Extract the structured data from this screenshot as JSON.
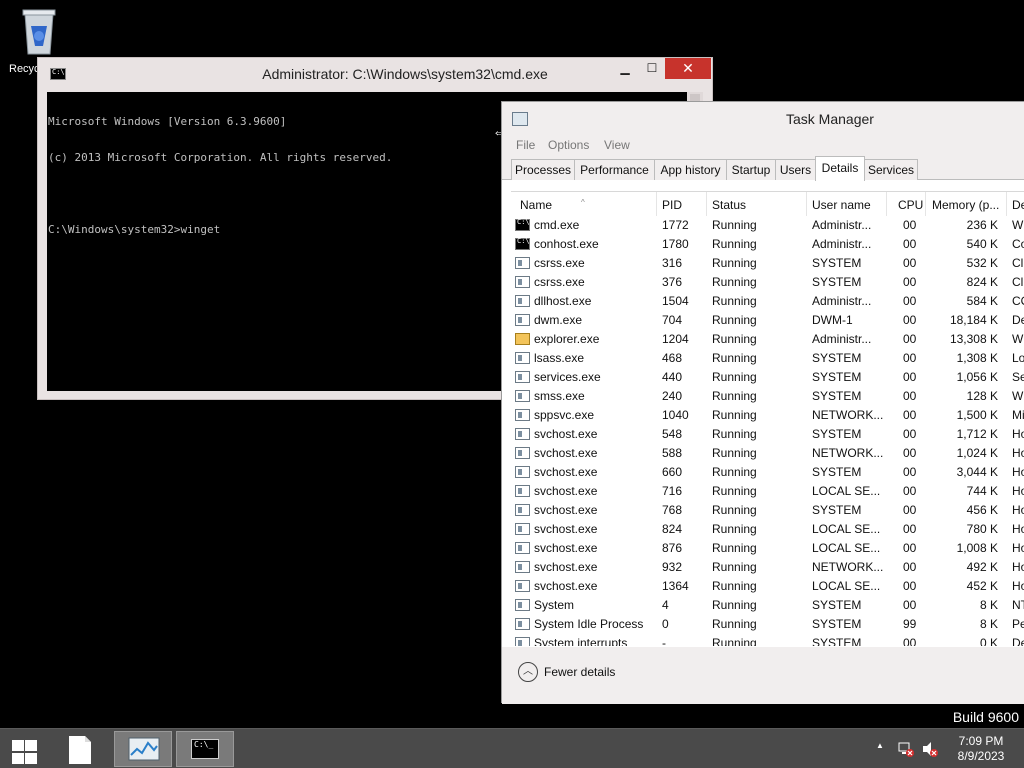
{
  "desktop": {
    "recycle_label": "Recyc",
    "build_label": "Build 9600"
  },
  "cmd": {
    "title": "Administrator: C:\\Windows\\system32\\cmd.exe",
    "minimize": "▁",
    "maximize": "☐",
    "close": "✕",
    "lines": [
      "Microsoft Windows [Version 6.3.9600]",
      "(c) 2013 Microsoft Corporation. All rights reserved.",
      "",
      "C:\\Windows\\system32>winget"
    ]
  },
  "taskmgr": {
    "title": "Task Manager",
    "menu": [
      "File",
      "Options",
      "View"
    ],
    "tabs": [
      "Processes",
      "Performance",
      "App history",
      "Startup",
      "Users",
      "Details",
      "Services"
    ],
    "active_tab": "Details",
    "columns": [
      "Name",
      "PID",
      "Status",
      "User name",
      "CPU",
      "Memory (p...",
      "De"
    ],
    "rows": [
      {
        "icon": "cmd",
        "name": "cmd.exe",
        "pid": "1772",
        "status": "Running",
        "user": "Administr...",
        "cpu": "00",
        "mem": "236 K",
        "desc": "Wi"
      },
      {
        "icon": "cmd",
        "name": "conhost.exe",
        "pid": "1780",
        "status": "Running",
        "user": "Administr...",
        "cpu": "00",
        "mem": "540 K",
        "desc": "Co"
      },
      {
        "icon": "gen",
        "name": "csrss.exe",
        "pid": "316",
        "status": "Running",
        "user": "SYSTEM",
        "cpu": "00",
        "mem": "532 K",
        "desc": "Cli"
      },
      {
        "icon": "gen",
        "name": "csrss.exe",
        "pid": "376",
        "status": "Running",
        "user": "SYSTEM",
        "cpu": "00",
        "mem": "824 K",
        "desc": "Cli"
      },
      {
        "icon": "gen",
        "name": "dllhost.exe",
        "pid": "1504",
        "status": "Running",
        "user": "Administr...",
        "cpu": "00",
        "mem": "584 K",
        "desc": "CO"
      },
      {
        "icon": "gen",
        "name": "dwm.exe",
        "pid": "704",
        "status": "Running",
        "user": "DWM-1",
        "cpu": "00",
        "mem": "18,184 K",
        "desc": "De"
      },
      {
        "icon": "exp",
        "name": "explorer.exe",
        "pid": "1204",
        "status": "Running",
        "user": "Administr...",
        "cpu": "00",
        "mem": "13,308 K",
        "desc": "Wi"
      },
      {
        "icon": "gen",
        "name": "lsass.exe",
        "pid": "468",
        "status": "Running",
        "user": "SYSTEM",
        "cpu": "00",
        "mem": "1,308 K",
        "desc": "Lo"
      },
      {
        "icon": "gen",
        "name": "services.exe",
        "pid": "440",
        "status": "Running",
        "user": "SYSTEM",
        "cpu": "00",
        "mem": "1,056 K",
        "desc": "Se"
      },
      {
        "icon": "gen",
        "name": "smss.exe",
        "pid": "240",
        "status": "Running",
        "user": "SYSTEM",
        "cpu": "00",
        "mem": "128 K",
        "desc": "Wi"
      },
      {
        "icon": "gen",
        "name": "sppsvc.exe",
        "pid": "1040",
        "status": "Running",
        "user": "NETWORK...",
        "cpu": "00",
        "mem": "1,500 K",
        "desc": "Mi"
      },
      {
        "icon": "gen",
        "name": "svchost.exe",
        "pid": "548",
        "status": "Running",
        "user": "SYSTEM",
        "cpu": "00",
        "mem": "1,712 K",
        "desc": "Ho"
      },
      {
        "icon": "gen",
        "name": "svchost.exe",
        "pid": "588",
        "status": "Running",
        "user": "NETWORK...",
        "cpu": "00",
        "mem": "1,024 K",
        "desc": "Ho"
      },
      {
        "icon": "gen",
        "name": "svchost.exe",
        "pid": "660",
        "status": "Running",
        "user": "SYSTEM",
        "cpu": "00",
        "mem": "3,044 K",
        "desc": "Ho"
      },
      {
        "icon": "gen",
        "name": "svchost.exe",
        "pid": "716",
        "status": "Running",
        "user": "LOCAL SE...",
        "cpu": "00",
        "mem": "744 K",
        "desc": "Ho"
      },
      {
        "icon": "gen",
        "name": "svchost.exe",
        "pid": "768",
        "status": "Running",
        "user": "SYSTEM",
        "cpu": "00",
        "mem": "456 K",
        "desc": "Ho"
      },
      {
        "icon": "gen",
        "name": "svchost.exe",
        "pid": "824",
        "status": "Running",
        "user": "LOCAL SE...",
        "cpu": "00",
        "mem": "780 K",
        "desc": "Ho"
      },
      {
        "icon": "gen",
        "name": "svchost.exe",
        "pid": "876",
        "status": "Running",
        "user": "LOCAL SE...",
        "cpu": "00",
        "mem": "1,008 K",
        "desc": "Ho"
      },
      {
        "icon": "gen",
        "name": "svchost.exe",
        "pid": "932",
        "status": "Running",
        "user": "NETWORK...",
        "cpu": "00",
        "mem": "492 K",
        "desc": "Ho"
      },
      {
        "icon": "gen",
        "name": "svchost.exe",
        "pid": "1364",
        "status": "Running",
        "user": "LOCAL SE...",
        "cpu": "00",
        "mem": "452 K",
        "desc": "Ho"
      },
      {
        "icon": "gen",
        "name": "System",
        "pid": "4",
        "status": "Running",
        "user": "SYSTEM",
        "cpu": "00",
        "mem": "8 K",
        "desc": "NT"
      },
      {
        "icon": "gen",
        "name": "System Idle Process",
        "pid": "0",
        "status": "Running",
        "user": "SYSTEM",
        "cpu": "99",
        "mem": "8 K",
        "desc": "Pe"
      },
      {
        "icon": "gen",
        "name": "System interrupts",
        "pid": "-",
        "status": "Running",
        "user": "SYSTEM",
        "cpu": "00",
        "mem": "0 K",
        "desc": "De"
      }
    ],
    "fewer_details": "Fewer details"
  },
  "taskbar": {
    "tray_arrow": "▲",
    "time": "7:09 PM",
    "date": "8/9/2023"
  },
  "colors": {
    "close_button": "#c7332c",
    "taskbar": "#4a4a4a",
    "chrome": "#f1eeee"
  }
}
